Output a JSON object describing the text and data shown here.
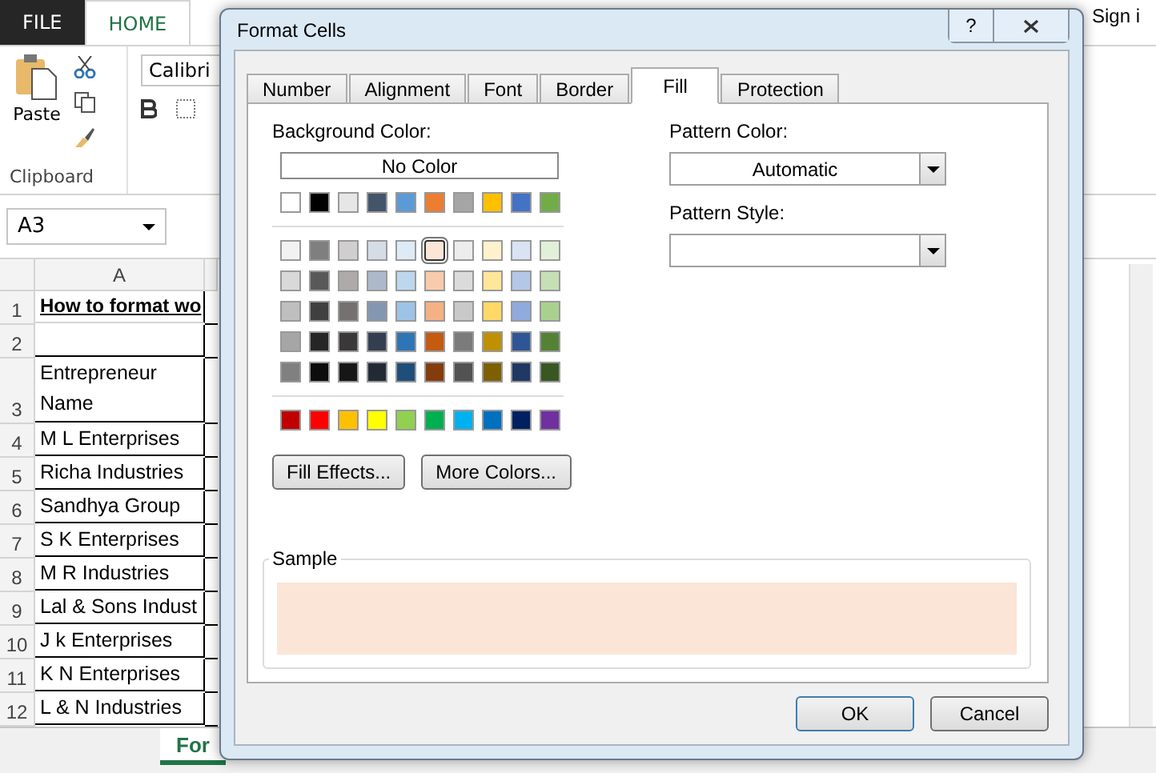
{
  "ribbon_tabs": [
    {
      "label": "FILE",
      "kind": "file",
      "selected": false
    },
    {
      "label": "HOME",
      "kind": "tab",
      "selected": true
    }
  ],
  "clipboard": {
    "paste": "Paste",
    "group_label": "Clipboard"
  },
  "font_box": {
    "value": "Calibri"
  },
  "account": {
    "label": "Sign i"
  },
  "name_box": {
    "value": "A3"
  },
  "columns": [
    "A"
  ],
  "rows": [
    {
      "number": "1",
      "cell": "How to format wo",
      "kind": "title"
    },
    {
      "number": "2",
      "cell": "",
      "kind": "text"
    },
    {
      "number": "3",
      "cell": "Entrepreneur Name",
      "kind": "tall"
    },
    {
      "number": "4",
      "cell": "M L Enterprises",
      "kind": "text"
    },
    {
      "number": "5",
      "cell": "Richa Industries",
      "kind": "text"
    },
    {
      "number": "6",
      "cell": "Sandhya Group",
      "kind": "text"
    },
    {
      "number": "7",
      "cell": "S K Enterprises",
      "kind": "text"
    },
    {
      "number": "8",
      "cell": "M R Industries",
      "kind": "text"
    },
    {
      "number": "9",
      "cell": "Lal & Sons Indust",
      "kind": "text"
    },
    {
      "number": "10",
      "cell": "J k Enterprises",
      "kind": "text"
    },
    {
      "number": "11",
      "cell": "K N Enterprises",
      "kind": "text"
    },
    {
      "number": "12",
      "cell": "L & N Industries",
      "kind": "text"
    }
  ],
  "sheet_tab": {
    "label": "For",
    "selected": true
  },
  "dialog": {
    "title": "Format Cells",
    "help": "?",
    "tabs": [
      {
        "label": "Number",
        "selected": false
      },
      {
        "label": "Alignment",
        "selected": false
      },
      {
        "label": "Font",
        "selected": false
      },
      {
        "label": "Border",
        "selected": false
      },
      {
        "label": "Fill",
        "selected": true
      },
      {
        "label": "Protection",
        "selected": false
      }
    ],
    "background_color": {
      "label": "Background Color:",
      "no_color": "No Color",
      "theme_colors": [
        {
          "color": "#ffffff",
          "selected": false
        },
        {
          "color": "#000000",
          "selected": false
        },
        {
          "color": "#e7e6e6",
          "selected": false
        },
        {
          "color": "#44546a",
          "selected": false
        },
        {
          "color": "#5b9bd5",
          "selected": false
        },
        {
          "color": "#ed7d31",
          "selected": false
        },
        {
          "color": "#a5a5a5",
          "selected": false
        },
        {
          "color": "#ffc000",
          "selected": false
        },
        {
          "color": "#4472c4",
          "selected": false
        },
        {
          "color": "#70ad47",
          "selected": false
        }
      ],
      "shade_rows": [
        [
          {
            "color": "#f2f2f2",
            "selected": false
          },
          {
            "color": "#7f7f7f",
            "selected": false
          },
          {
            "color": "#d0cece",
            "selected": false
          },
          {
            "color": "#d6dce5",
            "selected": false
          },
          {
            "color": "#deebf7",
            "selected": false
          },
          {
            "color": "#fbe5d6",
            "selected": true
          },
          {
            "color": "#ededed",
            "selected": false
          },
          {
            "color": "#fff2cc",
            "selected": false
          },
          {
            "color": "#dae3f3",
            "selected": false
          },
          {
            "color": "#e2f0d9",
            "selected": false
          }
        ],
        [
          {
            "color": "#d9d9d9",
            "selected": false
          },
          {
            "color": "#595959",
            "selected": false
          },
          {
            "color": "#aeaaaa",
            "selected": false
          },
          {
            "color": "#adb9ca",
            "selected": false
          },
          {
            "color": "#bdd7ee",
            "selected": false
          },
          {
            "color": "#f8cbad",
            "selected": false
          },
          {
            "color": "#dbdbdb",
            "selected": false
          },
          {
            "color": "#ffe699",
            "selected": false
          },
          {
            "color": "#b4c7e7",
            "selected": false
          },
          {
            "color": "#c5e0b4",
            "selected": false
          }
        ],
        [
          {
            "color": "#bfbfbf",
            "selected": false
          },
          {
            "color": "#404040",
            "selected": false
          },
          {
            "color": "#757171",
            "selected": false
          },
          {
            "color": "#8497b0",
            "selected": false
          },
          {
            "color": "#9dc3e6",
            "selected": false
          },
          {
            "color": "#f4b183",
            "selected": false
          },
          {
            "color": "#c9c9c9",
            "selected": false
          },
          {
            "color": "#ffd966",
            "selected": false
          },
          {
            "color": "#8faadc",
            "selected": false
          },
          {
            "color": "#a9d18e",
            "selected": false
          }
        ],
        [
          {
            "color": "#a6a6a6",
            "selected": false
          },
          {
            "color": "#262626",
            "selected": false
          },
          {
            "color": "#3a3838",
            "selected": false
          },
          {
            "color": "#333f50",
            "selected": false
          },
          {
            "color": "#2e75b6",
            "selected": false
          },
          {
            "color": "#c55a11",
            "selected": false
          },
          {
            "color": "#7b7b7b",
            "selected": false
          },
          {
            "color": "#bf9000",
            "selected": false
          },
          {
            "color": "#2f5597",
            "selected": false
          },
          {
            "color": "#548235",
            "selected": false
          }
        ],
        [
          {
            "color": "#808080",
            "selected": false
          },
          {
            "color": "#0d0d0d",
            "selected": false
          },
          {
            "color": "#171616",
            "selected": false
          },
          {
            "color": "#222a35",
            "selected": false
          },
          {
            "color": "#1f4e79",
            "selected": false
          },
          {
            "color": "#843c0c",
            "selected": false
          },
          {
            "color": "#525252",
            "selected": false
          },
          {
            "color": "#7f6000",
            "selected": false
          },
          {
            "color": "#203864",
            "selected": false
          },
          {
            "color": "#385723",
            "selected": false
          }
        ]
      ],
      "standard_colors": [
        {
          "color": "#c00000",
          "selected": false
        },
        {
          "color": "#ff0000",
          "selected": false
        },
        {
          "color": "#ffc000",
          "selected": false
        },
        {
          "color": "#ffff00",
          "selected": false
        },
        {
          "color": "#92d050",
          "selected": false
        },
        {
          "color": "#00b050",
          "selected": false
        },
        {
          "color": "#00b0f0",
          "selected": false
        },
        {
          "color": "#0070c0",
          "selected": false
        },
        {
          "color": "#002060",
          "selected": false
        },
        {
          "color": "#7030a0",
          "selected": false
        }
      ]
    },
    "fill_effects": "Fill Effects...",
    "more_colors": "More Colors...",
    "pattern_color": {
      "label": "Pattern Color:",
      "value": "Automatic"
    },
    "pattern_style": {
      "label": "Pattern Style:"
    },
    "sample": {
      "label": "Sample",
      "color": "#fbe5d6"
    },
    "buttons": [
      {
        "label": "OK",
        "kind": "default"
      },
      {
        "label": "Cancel",
        "kind": "normal"
      }
    ]
  }
}
